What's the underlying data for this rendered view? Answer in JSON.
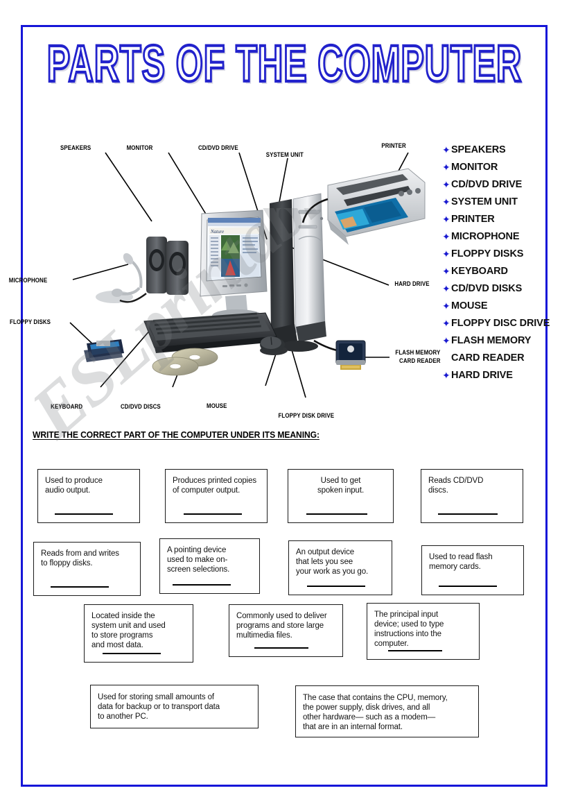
{
  "page": {
    "title": "PARTS OF THE COMPUTER",
    "border_color": "#1616d8",
    "watermark": "ESLprintables.com"
  },
  "diagram": {
    "callouts": [
      {
        "id": "speakers",
        "label": "SPEAKERS"
      },
      {
        "id": "monitor",
        "label": "MONITOR"
      },
      {
        "id": "cd-dvd-drive",
        "label": "CD/DVD DRIVE"
      },
      {
        "id": "system-unit",
        "label": "SYSTEM UNIT"
      },
      {
        "id": "printer",
        "label": "PRINTER"
      },
      {
        "id": "microphone",
        "label": "MICROPHONE"
      },
      {
        "id": "floppy-disks",
        "label": "FLOPPY DISKS"
      },
      {
        "id": "hard-drive",
        "label": "HARD DRIVE"
      },
      {
        "id": "flash-memory-card-reader-1",
        "label": "FLASH MEMORY"
      },
      {
        "id": "flash-memory-card-reader-2",
        "label": "CARD READER"
      },
      {
        "id": "keyboard",
        "label": "KEYBOARD"
      },
      {
        "id": "cd-dvd-discs",
        "label": "CD/DVD DISCS"
      },
      {
        "id": "mouse",
        "label": "MOUSE"
      },
      {
        "id": "floppy-disk-drive",
        "label": "FLOPPY DISK DRIVE"
      }
    ]
  },
  "vocabulary": {
    "bullet_color": "#1a1ad0",
    "items": [
      {
        "label": "SPEAKERS",
        "bulleted": true
      },
      {
        "label": "MONITOR",
        "bulleted": true
      },
      {
        "label": "CD/DVD DRIVE",
        "bulleted": true
      },
      {
        "label": "SYSTEM UNIT",
        "bulleted": true
      },
      {
        "label": "PRINTER",
        "bulleted": true
      },
      {
        "label": "MICROPHONE",
        "bulleted": true
      },
      {
        "label": "FLOPPY DISKS",
        "bulleted": true
      },
      {
        "label": "KEYBOARD",
        "bulleted": true
      },
      {
        "label": "CD/DVD DISKS",
        "bulleted": true
      },
      {
        "label": "MOUSE",
        "bulleted": true
      },
      {
        "label": "FLOPPY DISC DRIVE",
        "bulleted": true
      },
      {
        "label": "FLASH MEMORY",
        "bulleted": true
      },
      {
        "label": "CARD READER",
        "bulleted": false
      },
      {
        "label": "HARD DRIVE",
        "bulleted": true
      }
    ]
  },
  "exercise": {
    "instruction": "WRITE THE CORRECT PART OF THE COMPUTER UNDER ITS MEANING:",
    "boxes": [
      {
        "id": "box-speakers",
        "text": "Used to produce\naudio output.",
        "has_blank": true,
        "align": "left"
      },
      {
        "id": "box-printer",
        "text": "Produces printed copies\nof computer output.",
        "has_blank": true,
        "align": "left"
      },
      {
        "id": "box-microphone",
        "text": "Used to get\nspoken input.",
        "has_blank": true,
        "align": "center"
      },
      {
        "id": "box-cddvd-drive",
        "text": "Reads CD/DVD\ndiscs.",
        "has_blank": true,
        "align": "left"
      },
      {
        "id": "box-floppy-drive",
        "text": "Reads from and writes\nto floppy disks.",
        "has_blank": true,
        "align": "left"
      },
      {
        "id": "box-mouse",
        "text": "A pointing device\nused to make on-\nscreen selections.",
        "has_blank": true,
        "align": "left"
      },
      {
        "id": "box-monitor",
        "text": "An output device\nthat lets you see\nyour work as you go.",
        "has_blank": true,
        "align": "left"
      },
      {
        "id": "box-card-reader",
        "text": "Used to read flash\nmemory cards.",
        "has_blank": true,
        "align": "left"
      },
      {
        "id": "box-hard-drive",
        "text": "Located inside the\nsystem unit and used\nto store programs\nand most data.",
        "has_blank": true,
        "align": "left"
      },
      {
        "id": "box-cddvd-discs",
        "text": "Commonly used to deliver\nprograms and store large\nmultimedia files.",
        "has_blank": true,
        "align": "left"
      },
      {
        "id": "box-keyboard",
        "text": "The principal input\ndevice; used to type\ninstructions into the\ncomputer.",
        "has_blank": true,
        "align": "left"
      },
      {
        "id": "box-floppy-disks",
        "text": "Used for storing  small amounts of\ndata for backup or  to transport data\n   to another PC.",
        "has_blank": false,
        "align": "left"
      },
      {
        "id": "box-system-unit",
        "text": "The case that contains the CPU, memory,\nthe power supply, disk drives, and all\nother hardware— such as a modem—\nthat are in an internal format.",
        "has_blank": false,
        "align": "left"
      }
    ]
  }
}
